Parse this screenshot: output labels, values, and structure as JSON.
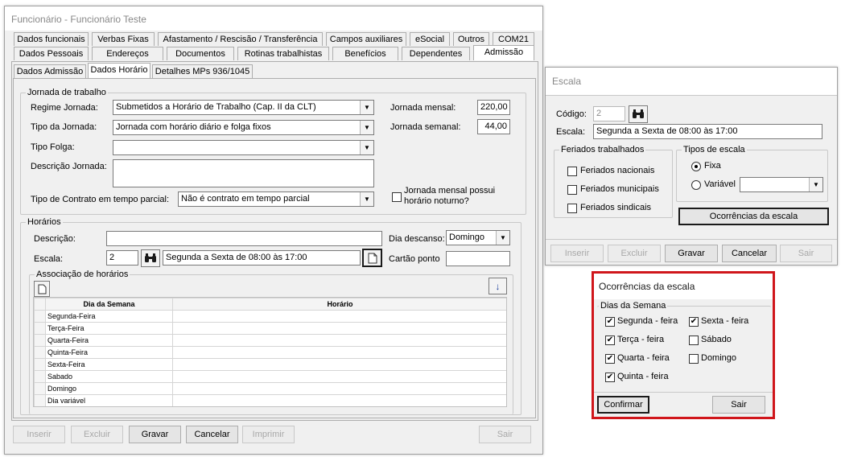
{
  "main_window": {
    "title": "Funcionário - Funcionário Teste",
    "tabs_row1": [
      "Dados funcionais",
      "Verbas Fixas",
      "Afastamento / Rescisão / Transferência",
      "Campos auxiliares",
      "eSocial",
      "Outros",
      "COM21"
    ],
    "tabs_row2": [
      "Dados Pessoais",
      "Endereços",
      "Documentos",
      "Rotinas trabalhistas",
      "Benefícios",
      "Dependentes",
      "Admissão"
    ],
    "tabs_row3": [
      "Dados Admissão",
      "Dados Horário",
      "Detalhes MPs  936/1045"
    ],
    "jornada": {
      "legend": "Jornada de trabalho",
      "regime_label": "Regime Jornada:",
      "regime_value": "Submetidos a Horário de Trabalho (Cap. II da CLT)",
      "tipo_label": "Tipo da Jornada:",
      "tipo_value": "Jornada com horário diário e folga fixos",
      "folga_label": "Tipo Folga:",
      "folga_value": "",
      "descricao_label": "Descrição Jornada:",
      "descricao_value": "",
      "contrato_label": "Tipo de Contrato em tempo parcial:",
      "contrato_value": "Não é contrato em tempo parcial",
      "mensal_label": "Jornada mensal:",
      "mensal_value": "220,00",
      "semanal_label": "Jornada semanal:",
      "semanal_value": "44,00",
      "noturno_label_1": "Jornada mensal possui",
      "noturno_label_2": "horário noturno?"
    },
    "horarios": {
      "legend": "Horários",
      "descricao_label": "Descrição:",
      "descricao_value": "",
      "escala_label": "Escala:",
      "escala_code": "2",
      "escala_name": "Segunda a Sexta de 08:00 às 17:00",
      "dia_descanso_label": "Dia descanso:",
      "dia_descanso_value": "Domingo",
      "cartao_label": "Cartão ponto",
      "cartao_value": "",
      "assoc_legend": "Associação de horários",
      "col_dia": "Dia da Semana",
      "col_horario": "Horário",
      "dias": [
        "Segunda-Feira",
        "Terça-Feira",
        "Quarta-Feira",
        "Quinta-Feira",
        "Sexta-Feira",
        "Sabado",
        "Domingo",
        "Dia variável"
      ]
    },
    "buttons": {
      "inserir": "Inserir",
      "excluir": "Excluir",
      "gravar": "Gravar",
      "cancelar": "Cancelar",
      "imprimir": "Imprimir",
      "sair": "Sair"
    }
  },
  "escala_window": {
    "title": "Escala",
    "codigo_label": "Código:",
    "codigo_value": "2",
    "escala_label": "Escala:",
    "escala_value": "Segunda a Sexta de 08:00 às 17:00",
    "feriados_legend": "Feriados trabalhados",
    "feriados": [
      "Feriados nacionais",
      "Feriados municipais",
      "Feriados sindicais"
    ],
    "tipos_legend": "Tipos de escala",
    "fixa_label": "Fixa",
    "variavel_label": "Variável",
    "variavel_value": "",
    "ocorrencias_button": "Ocorrências da escala",
    "buttons": {
      "inserir": "Inserir",
      "excluir": "Excluir",
      "gravar": "Gravar",
      "cancelar": "Cancelar",
      "sair": "Sair"
    }
  },
  "ocorrencias_window": {
    "title": "Ocorrências da escala",
    "dias_legend": "Dias da Semana",
    "dias": [
      {
        "label": "Segunda - feira",
        "checked": true
      },
      {
        "label": "Terça - feira",
        "checked": true
      },
      {
        "label": "Quarta - feira",
        "checked": true
      },
      {
        "label": "Quinta - feira",
        "checked": true
      },
      {
        "label": "Sexta - feira",
        "checked": true
      },
      {
        "label": "Sábado",
        "checked": false
      },
      {
        "label": "Domingo",
        "checked": false
      }
    ],
    "confirmar_button": "Confirmar",
    "sair_button": "Sair",
    "highlight_color": "#d0161b"
  }
}
